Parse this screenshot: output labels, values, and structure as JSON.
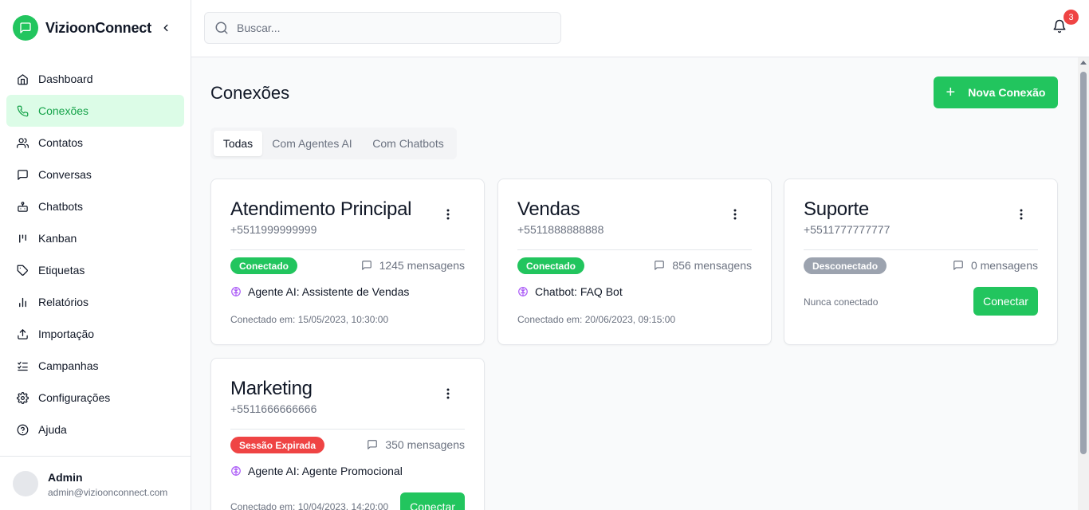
{
  "app": {
    "name": "VizioonConnect"
  },
  "nav": [
    {
      "label": "Dashboard",
      "icon": "home-icon",
      "active": false
    },
    {
      "label": "Conexões",
      "icon": "phone-icon",
      "active": true
    },
    {
      "label": "Contatos",
      "icon": "users-icon",
      "active": false
    },
    {
      "label": "Conversas",
      "icon": "message-square-icon",
      "active": false
    },
    {
      "label": "Chatbots",
      "icon": "bot-icon",
      "active": false
    },
    {
      "label": "Kanban",
      "icon": "kanban-icon",
      "active": false
    },
    {
      "label": "Etiquetas",
      "icon": "tag-icon",
      "active": false
    },
    {
      "label": "Relatórios",
      "icon": "bar-chart-icon",
      "active": false
    },
    {
      "label": "Importação",
      "icon": "upload-icon",
      "active": false
    },
    {
      "label": "Campanhas",
      "icon": "list-checks-icon",
      "active": false
    },
    {
      "label": "Configurações",
      "icon": "settings-icon",
      "active": false
    },
    {
      "label": "Ajuda",
      "icon": "help-circle-icon",
      "active": false
    }
  ],
  "user": {
    "name": "Admin",
    "email": "admin@vizioonconnect.com"
  },
  "search": {
    "placeholder": "Buscar..."
  },
  "notifications": {
    "count": "3"
  },
  "page": {
    "title": "Conexões",
    "new_button": "Nova Conexão"
  },
  "tabs": [
    {
      "label": "Todas",
      "active": true
    },
    {
      "label": "Com Agentes AI",
      "active": false
    },
    {
      "label": "Com Chatbots",
      "active": false
    }
  ],
  "connections": [
    {
      "name": "Atendimento Principal",
      "phone": "+5511999999999",
      "status": "Conectado",
      "status_color": "#22c55e",
      "messages": "1245 mensagens",
      "agent": "Agente AI: Assistente de Vendas",
      "footer": "Conectado em: 15/05/2023, 10:30:00"
    },
    {
      "name": "Vendas",
      "phone": "+5511888888888",
      "status": "Conectado",
      "status_color": "#22c55e",
      "messages": "856 mensagens",
      "agent": "Chatbot: FAQ Bot",
      "footer": "Conectado em: 20/06/2023, 09:15:00"
    },
    {
      "name": "Suporte",
      "phone": "+5511777777777",
      "status": "Desconectado",
      "status_color": "#9ca3af",
      "messages": "0 mensagens",
      "footer": "Nunca conectado",
      "action": "Conectar"
    },
    {
      "name": "Marketing",
      "phone": "+5511666666666",
      "status": "Sessão Expirada",
      "status_color": "#ef4444",
      "messages": "350 mensagens",
      "agent": "Agente AI: Agente Promocional",
      "footer": "Conectado em: 10/04/2023, 14:20:00",
      "action": "Conectar"
    }
  ],
  "colors": {
    "accent": "#22c55e",
    "accent_light": "#dcfce7",
    "agent_icon": "#a855f7"
  }
}
